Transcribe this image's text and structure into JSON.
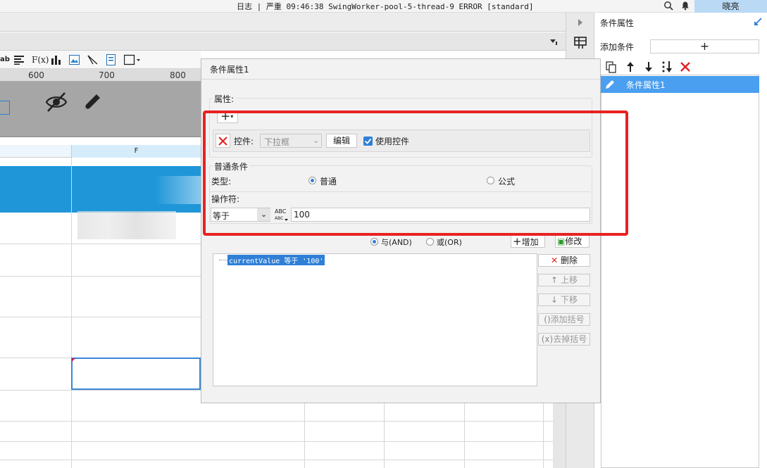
{
  "topbar": {
    "log_text": "日志 | 严重 09:46:38 SwingWorker-pool-5-thread-9 ERROR [standard]",
    "user_name": "晓亮",
    "icons": [
      "search-icon",
      "bell-icon"
    ]
  },
  "editor": {
    "toolbar_icons": [
      "align-icon",
      "formula-icon",
      "chart-icon",
      "image-icon",
      "slash-icon",
      "file-icon",
      "border-icon"
    ],
    "formula_text": "F(x)",
    "ruler_ticks": [
      "600",
      "700",
      "800"
    ],
    "column_header": "F",
    "accent_color": "#1f96d8"
  },
  "right_panel": {
    "title": "条件属性",
    "add_condition_label": "添加条件",
    "add_button": "+",
    "toolbar_icons": [
      "copy-icon",
      "move-up-icon",
      "move-down-icon",
      "sort-icon",
      "delete-icon"
    ],
    "items": [
      {
        "label": "条件属性1",
        "selected": true
      }
    ]
  },
  "dialog": {
    "title": "条件属性1",
    "property_section": "属性:",
    "add_button": "+",
    "widget_label": "控件:",
    "widget_select": "下拉框",
    "edit_button": "编辑",
    "use_widget_label": "使用控件",
    "use_widget_checked": true,
    "normal_section": "普通条件",
    "type_label": "类型:",
    "type_options": [
      "普通",
      "公式"
    ],
    "type_selected": "普通",
    "operator_label": "操作符:",
    "operator_value": "等于",
    "value": "100",
    "logic_and": "与(AND)",
    "logic_or": "或(OR)",
    "logic_selected": "与(AND)",
    "add_cond_button": "增加",
    "modify_button": "修改",
    "condition_text": "currentValue 等于 '100'",
    "side_buttons": [
      "删除",
      "上移",
      "下移",
      "添加括号",
      "去掉括号"
    ]
  },
  "colors": {
    "highlight_red": "#e82222",
    "selection_blue": "#4a9ff0"
  }
}
